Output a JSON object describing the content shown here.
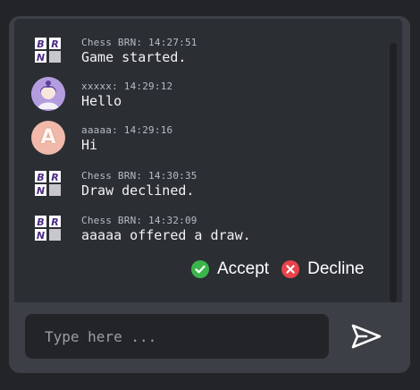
{
  "messages": [
    {
      "avatar": "chess-brn-bot-icon",
      "meta": "Chess BRN: 14:27:51",
      "text": "Game started."
    },
    {
      "avatar": "user-avatar-icon",
      "meta": "xxxxx: 14:29:12",
      "text": "Hello"
    },
    {
      "avatar": "letter-avatar",
      "avatar_letter": "A",
      "meta": "aaaaa: 14:29:16",
      "text": "Hi"
    },
    {
      "avatar": "chess-brn-bot-icon",
      "meta": "Chess BRN: 14:30:35",
      "text": "Draw declined."
    },
    {
      "avatar": "chess-brn-bot-icon",
      "meta": "Chess BRN: 14:32:09",
      "text": "aaaaa offered a draw."
    }
  ],
  "bot_logo_letters": "BRN",
  "draw_offer": {
    "accept_label": "Accept",
    "decline_label": "Decline",
    "accept_color": "#3bb54a",
    "decline_color": "#e8434a"
  },
  "composer": {
    "placeholder": "Type here ..."
  },
  "colors": {
    "page_bg": "#222428",
    "panel_bg": "#3c3f45",
    "chat_bg": "#2b2e33",
    "input_bg": "#222428",
    "text": "#f1f2f4",
    "meta_text": "#b8bcc4"
  }
}
